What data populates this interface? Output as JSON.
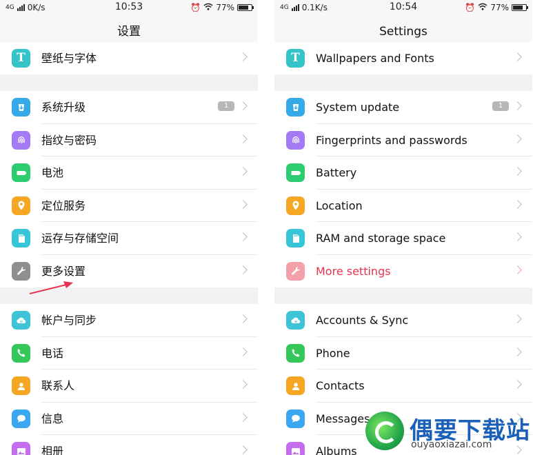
{
  "left": {
    "status": {
      "network": "4G",
      "speed": "0K/s",
      "time": "10:53",
      "battery": "77%",
      "battery_level": 0.77
    },
    "title": "设置",
    "groups": [
      {
        "items": [
          {
            "label": "壁纸与字体",
            "icon": "theme-t-icon",
            "color": "#34c3c7"
          }
        ]
      },
      {
        "items": [
          {
            "label": "系统升级",
            "icon": "system-update-icon",
            "color": "#36a9e8",
            "badge": "1"
          },
          {
            "label": "指纹与密码",
            "icon": "fingerprint-icon",
            "color": "#a57af5"
          },
          {
            "label": "电池",
            "icon": "battery-icon",
            "color": "#2ecc71"
          },
          {
            "label": "定位服务",
            "icon": "location-pin-icon",
            "color": "#f5a623"
          },
          {
            "label": "运存与存储空间",
            "icon": "sd-card-icon",
            "color": "#36c6d8"
          },
          {
            "label": "更多设置",
            "icon": "wrench-icon",
            "color": "#8f8f8f"
          }
        ]
      },
      {
        "items": [
          {
            "label": "帐户与同步",
            "icon": "cloud-sync-icon",
            "color": "#3ec4d6"
          },
          {
            "label": "电话",
            "icon": "phone-icon",
            "color": "#34c759"
          },
          {
            "label": "联系人",
            "icon": "contacts-icon",
            "color": "#f5a623"
          },
          {
            "label": "信息",
            "icon": "message-icon",
            "color": "#3aa7f0"
          },
          {
            "label": "相册",
            "icon": "album-icon",
            "color": "#c56cf0"
          }
        ]
      }
    ]
  },
  "right": {
    "status": {
      "network": "4G",
      "speed": "0.1K/s",
      "time": "10:54",
      "battery": "77%",
      "battery_level": 0.77
    },
    "title": "Settings",
    "groups": [
      {
        "items": [
          {
            "label": "Wallpapers and Fonts",
            "icon": "theme-t-icon",
            "color": "#34c3c7"
          }
        ]
      },
      {
        "items": [
          {
            "label": "System update",
            "icon": "system-update-icon",
            "color": "#36a9e8",
            "badge": "1"
          },
          {
            "label": "Fingerprints and passwords",
            "icon": "fingerprint-icon",
            "color": "#a57af5"
          },
          {
            "label": "Battery",
            "icon": "battery-icon",
            "color": "#2ecc71"
          },
          {
            "label": "Location",
            "icon": "location-pin-icon",
            "color": "#f5a623"
          },
          {
            "label": "RAM and storage space",
            "icon": "sd-card-icon",
            "color": "#36c6d8"
          },
          {
            "label": "More settings",
            "icon": "wrench-icon",
            "color": "#f4a0a8",
            "highlight": "#e8344e"
          }
        ]
      },
      {
        "items": [
          {
            "label": "Accounts & Sync",
            "icon": "cloud-sync-icon",
            "color": "#3ec4d6"
          },
          {
            "label": "Phone",
            "icon": "phone-icon",
            "color": "#34c759"
          },
          {
            "label": "Contacts",
            "icon": "contacts-icon",
            "color": "#f5a623"
          },
          {
            "label": "Messages",
            "icon": "message-icon",
            "color": "#3aa7f0"
          },
          {
            "label": "Albums",
            "icon": "album-icon",
            "color": "#c56cf0"
          }
        ]
      }
    ]
  },
  "watermark": {
    "title": "偶要下载站",
    "url": "ouyaoxiazai.com"
  },
  "annotation": {
    "color": "#e8344e"
  }
}
